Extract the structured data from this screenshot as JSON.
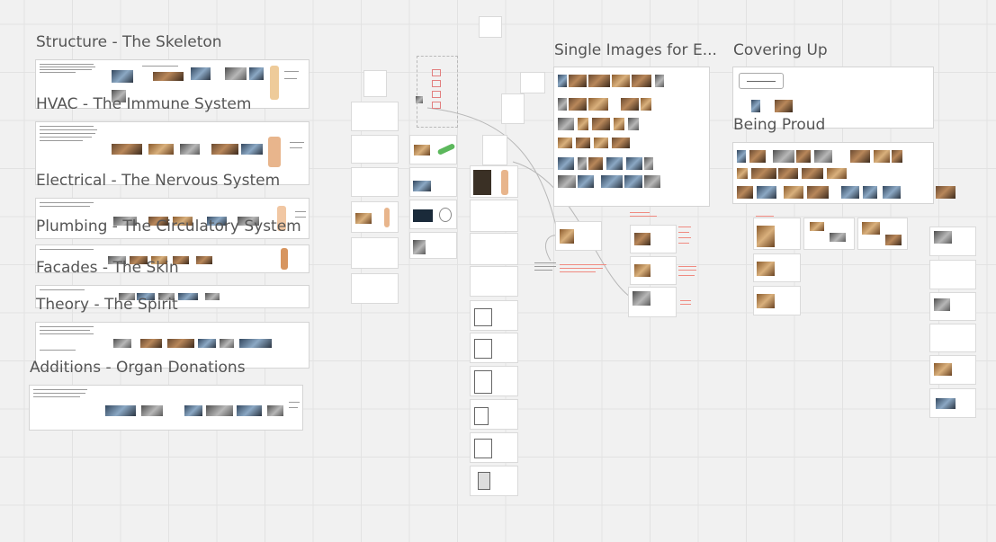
{
  "sections": [
    {
      "key": "structure",
      "title": "Structure - The Skeleton"
    },
    {
      "key": "hvac",
      "title": "HVAC - The Immune System"
    },
    {
      "key": "electrical",
      "title": "Electrical - The Nervous System"
    },
    {
      "key": "plumbing",
      "title": "Plumbing - The Circulatory System"
    },
    {
      "key": "facades",
      "title": "Facades - The Skin"
    },
    {
      "key": "theory",
      "title": "Theory - The Spirit"
    },
    {
      "key": "additions",
      "title": "Additions - Organ Donations"
    },
    {
      "key": "single_images",
      "title": "Single Images for E..."
    },
    {
      "key": "covering_up",
      "title": "Covering Up"
    },
    {
      "key": "being_proud",
      "title": "Being Proud"
    }
  ],
  "colors": {
    "canvas_bg": "#f1f1f1",
    "grid_line": "#e2e2e2",
    "title_text": "#555555",
    "annotation_red": "#f08a80",
    "sticker_green": "#5cb85c"
  }
}
